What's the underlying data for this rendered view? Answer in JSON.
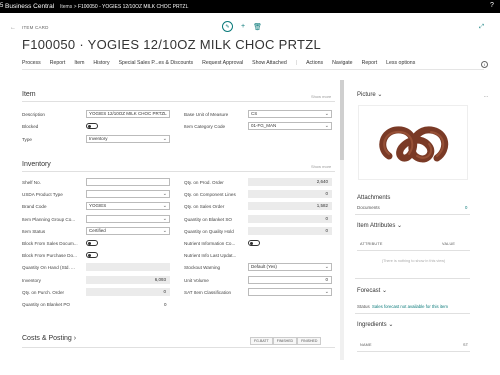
{
  "topbar": {
    "left_edge": "5",
    "app_name": "Business Central",
    "crumb_prev": "Items",
    "crumb_current": "F100050 - YOGIES 12/10OZ MILK CHOC PRTZL"
  },
  "header": {
    "card_type": "ITEM CARD",
    "title": "F100050 · YOGIES 12/10OZ MILK CHOC PRTZL"
  },
  "actions": [
    "Process",
    "Report",
    "Item",
    "History",
    "Special Sales P...es & Discounts",
    "Request Approval",
    "Show Attached",
    "|",
    "Actions",
    "Navigate",
    "Report",
    "Less options"
  ],
  "item": {
    "heading": "Item",
    "show_more": "Show more",
    "description_label": "Description",
    "description_value": "YOGIES 12/10OZ MILK CHOC PRTZL",
    "blocked_label": "Blocked",
    "type_label": "Type",
    "type_value": "Inventory",
    "base_uom_label": "Base Unit of Measure",
    "base_uom_value": "CS",
    "item_category_label": "Item Category Code",
    "item_category_value": "01-FG_MAN"
  },
  "inventory": {
    "heading": "Inventory",
    "show_more": "Show more",
    "left": [
      {
        "label": "Shelf No.",
        "value": "",
        "kind": "input"
      },
      {
        "label": "USDA Product Type",
        "value": "",
        "kind": "select"
      },
      {
        "label": "Brand Code",
        "value": "YOGIES",
        "kind": "select"
      },
      {
        "label": "Item Planning Group Co...",
        "value": "",
        "kind": "select"
      },
      {
        "label": "Item Status",
        "value": "Certified",
        "kind": "select"
      },
      {
        "label": "Block From Sales Docum...",
        "value": "",
        "kind": "toggle"
      },
      {
        "label": "Block From Purchase Do...",
        "value": "",
        "kind": "toggle"
      },
      {
        "label": "Quantity On Hand (Std. ...",
        "value": "",
        "kind": "readonly"
      },
      {
        "label": "Inventory",
        "value": "6,093",
        "kind": "readonly"
      },
      {
        "label": "Qty. on Purch. Order",
        "value": "0",
        "kind": "readonly"
      },
      {
        "label": "Quantity on Blanket PO",
        "value": "0",
        "kind": "plain"
      }
    ],
    "right": [
      {
        "label": "Qty. on Prod. Order",
        "value": "2,640",
        "kind": "readonly"
      },
      {
        "label": "Qty. on Component Lines",
        "value": "0",
        "kind": "readonly"
      },
      {
        "label": "Qty. on Sales Order",
        "value": "1,582",
        "kind": "readonly"
      },
      {
        "label": "Quantity on Blanket SO",
        "value": "0",
        "kind": "readonly"
      },
      {
        "label": "Quantity on Quality Hold",
        "value": "0",
        "kind": "readonly"
      },
      {
        "label": "Nutrient Information Co...",
        "value": "",
        "kind": "toggle"
      },
      {
        "label": "Nutrient Info Last Updat...",
        "value": "",
        "kind": "plain"
      },
      {
        "label": "Stockout Warning",
        "value": "Default (Yes)",
        "kind": "select"
      },
      {
        "label": "Unit Volume",
        "value": "0",
        "kind": "input_num"
      },
      {
        "label": "SAT Item Classification",
        "value": "",
        "kind": "select"
      }
    ]
  },
  "costs": {
    "heading": "Costs & Posting",
    "chips": [
      "FG-BATT",
      "FINISHED",
      "FINISHED"
    ]
  },
  "side": {
    "picture_heading": "Picture",
    "dots": "...",
    "attachments_heading": "Attachments",
    "documents_label": "Documents",
    "documents_value": "0",
    "attributes_heading": "Item Attributes",
    "attr_col1": "ATTRIBUTE",
    "attr_col2": "VALUE",
    "attr_empty": "(There is nothing to show in this view)",
    "forecast_heading": "Forecast",
    "status_label": "Status",
    "status_value": "Sales forecast not available for this item",
    "ingredients_heading": "Ingredients",
    "ing_col1": "NAME",
    "ing_col2": "ST"
  }
}
